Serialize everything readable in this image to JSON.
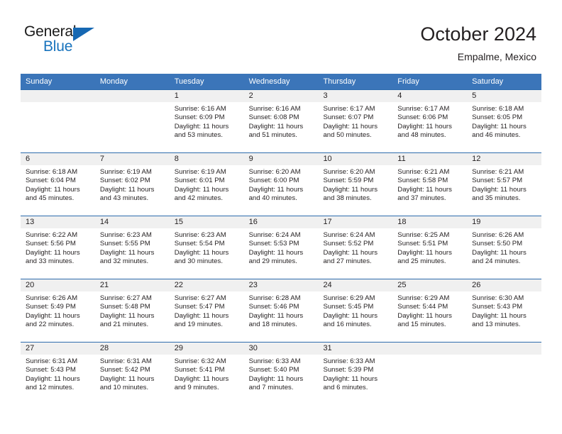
{
  "brand": {
    "name_top": "General",
    "name_bottom": "Blue",
    "triangle_color": "#1668b3",
    "text_color": "#1a1a1a",
    "blue_color": "#1873bd"
  },
  "header": {
    "title": "October 2024",
    "subtitle": "Empalme, Mexico"
  },
  "theme": {
    "header_blue": "#3b75b9",
    "row_divider_blue": "#2e6cad",
    "daynum_band": "#f0f0f0"
  },
  "weekdays": [
    "Sunday",
    "Monday",
    "Tuesday",
    "Wednesday",
    "Thursday",
    "Friday",
    "Saturday"
  ],
  "weeks": [
    [
      {
        "day": "",
        "l1": "",
        "l2": "",
        "l3": "",
        "l4": ""
      },
      {
        "day": "",
        "l1": "",
        "l2": "",
        "l3": "",
        "l4": ""
      },
      {
        "day": "1",
        "l1": "Sunrise: 6:16 AM",
        "l2": "Sunset: 6:09 PM",
        "l3": "Daylight: 11 hours",
        "l4": "and 53 minutes."
      },
      {
        "day": "2",
        "l1": "Sunrise: 6:16 AM",
        "l2": "Sunset: 6:08 PM",
        "l3": "Daylight: 11 hours",
        "l4": "and 51 minutes."
      },
      {
        "day": "3",
        "l1": "Sunrise: 6:17 AM",
        "l2": "Sunset: 6:07 PM",
        "l3": "Daylight: 11 hours",
        "l4": "and 50 minutes."
      },
      {
        "day": "4",
        "l1": "Sunrise: 6:17 AM",
        "l2": "Sunset: 6:06 PM",
        "l3": "Daylight: 11 hours",
        "l4": "and 48 minutes."
      },
      {
        "day": "5",
        "l1": "Sunrise: 6:18 AM",
        "l2": "Sunset: 6:05 PM",
        "l3": "Daylight: 11 hours",
        "l4": "and 46 minutes."
      }
    ],
    [
      {
        "day": "6",
        "l1": "Sunrise: 6:18 AM",
        "l2": "Sunset: 6:04 PM",
        "l3": "Daylight: 11 hours",
        "l4": "and 45 minutes."
      },
      {
        "day": "7",
        "l1": "Sunrise: 6:19 AM",
        "l2": "Sunset: 6:02 PM",
        "l3": "Daylight: 11 hours",
        "l4": "and 43 minutes."
      },
      {
        "day": "8",
        "l1": "Sunrise: 6:19 AM",
        "l2": "Sunset: 6:01 PM",
        "l3": "Daylight: 11 hours",
        "l4": "and 42 minutes."
      },
      {
        "day": "9",
        "l1": "Sunrise: 6:20 AM",
        "l2": "Sunset: 6:00 PM",
        "l3": "Daylight: 11 hours",
        "l4": "and 40 minutes."
      },
      {
        "day": "10",
        "l1": "Sunrise: 6:20 AM",
        "l2": "Sunset: 5:59 PM",
        "l3": "Daylight: 11 hours",
        "l4": "and 38 minutes."
      },
      {
        "day": "11",
        "l1": "Sunrise: 6:21 AM",
        "l2": "Sunset: 5:58 PM",
        "l3": "Daylight: 11 hours",
        "l4": "and 37 minutes."
      },
      {
        "day": "12",
        "l1": "Sunrise: 6:21 AM",
        "l2": "Sunset: 5:57 PM",
        "l3": "Daylight: 11 hours",
        "l4": "and 35 minutes."
      }
    ],
    [
      {
        "day": "13",
        "l1": "Sunrise: 6:22 AM",
        "l2": "Sunset: 5:56 PM",
        "l3": "Daylight: 11 hours",
        "l4": "and 33 minutes."
      },
      {
        "day": "14",
        "l1": "Sunrise: 6:23 AM",
        "l2": "Sunset: 5:55 PM",
        "l3": "Daylight: 11 hours",
        "l4": "and 32 minutes."
      },
      {
        "day": "15",
        "l1": "Sunrise: 6:23 AM",
        "l2": "Sunset: 5:54 PM",
        "l3": "Daylight: 11 hours",
        "l4": "and 30 minutes."
      },
      {
        "day": "16",
        "l1": "Sunrise: 6:24 AM",
        "l2": "Sunset: 5:53 PM",
        "l3": "Daylight: 11 hours",
        "l4": "and 29 minutes."
      },
      {
        "day": "17",
        "l1": "Sunrise: 6:24 AM",
        "l2": "Sunset: 5:52 PM",
        "l3": "Daylight: 11 hours",
        "l4": "and 27 minutes."
      },
      {
        "day": "18",
        "l1": "Sunrise: 6:25 AM",
        "l2": "Sunset: 5:51 PM",
        "l3": "Daylight: 11 hours",
        "l4": "and 25 minutes."
      },
      {
        "day": "19",
        "l1": "Sunrise: 6:26 AM",
        "l2": "Sunset: 5:50 PM",
        "l3": "Daylight: 11 hours",
        "l4": "and 24 minutes."
      }
    ],
    [
      {
        "day": "20",
        "l1": "Sunrise: 6:26 AM",
        "l2": "Sunset: 5:49 PM",
        "l3": "Daylight: 11 hours",
        "l4": "and 22 minutes."
      },
      {
        "day": "21",
        "l1": "Sunrise: 6:27 AM",
        "l2": "Sunset: 5:48 PM",
        "l3": "Daylight: 11 hours",
        "l4": "and 21 minutes."
      },
      {
        "day": "22",
        "l1": "Sunrise: 6:27 AM",
        "l2": "Sunset: 5:47 PM",
        "l3": "Daylight: 11 hours",
        "l4": "and 19 minutes."
      },
      {
        "day": "23",
        "l1": "Sunrise: 6:28 AM",
        "l2": "Sunset: 5:46 PM",
        "l3": "Daylight: 11 hours",
        "l4": "and 18 minutes."
      },
      {
        "day": "24",
        "l1": "Sunrise: 6:29 AM",
        "l2": "Sunset: 5:45 PM",
        "l3": "Daylight: 11 hours",
        "l4": "and 16 minutes."
      },
      {
        "day": "25",
        "l1": "Sunrise: 6:29 AM",
        "l2": "Sunset: 5:44 PM",
        "l3": "Daylight: 11 hours",
        "l4": "and 15 minutes."
      },
      {
        "day": "26",
        "l1": "Sunrise: 6:30 AM",
        "l2": "Sunset: 5:43 PM",
        "l3": "Daylight: 11 hours",
        "l4": "and 13 minutes."
      }
    ],
    [
      {
        "day": "27",
        "l1": "Sunrise: 6:31 AM",
        "l2": "Sunset: 5:43 PM",
        "l3": "Daylight: 11 hours",
        "l4": "and 12 minutes."
      },
      {
        "day": "28",
        "l1": "Sunrise: 6:31 AM",
        "l2": "Sunset: 5:42 PM",
        "l3": "Daylight: 11 hours",
        "l4": "and 10 minutes."
      },
      {
        "day": "29",
        "l1": "Sunrise: 6:32 AM",
        "l2": "Sunset: 5:41 PM",
        "l3": "Daylight: 11 hours",
        "l4": "and 9 minutes."
      },
      {
        "day": "30",
        "l1": "Sunrise: 6:33 AM",
        "l2": "Sunset: 5:40 PM",
        "l3": "Daylight: 11 hours",
        "l4": "and 7 minutes."
      },
      {
        "day": "31",
        "l1": "Sunrise: 6:33 AM",
        "l2": "Sunset: 5:39 PM",
        "l3": "Daylight: 11 hours",
        "l4": "and 6 minutes."
      },
      {
        "day": "",
        "l1": "",
        "l2": "",
        "l3": "",
        "l4": ""
      },
      {
        "day": "",
        "l1": "",
        "l2": "",
        "l3": "",
        "l4": ""
      }
    ]
  ]
}
